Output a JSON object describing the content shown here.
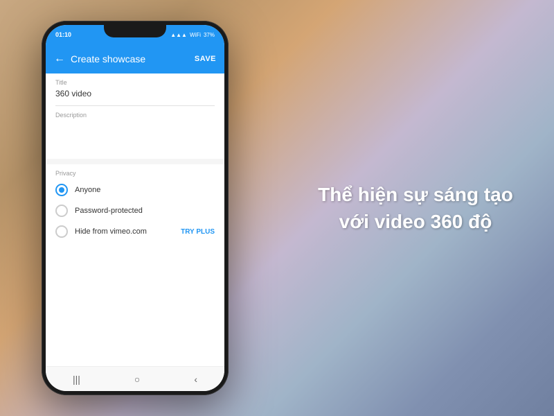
{
  "background": {
    "gradient": "linear-gradient(135deg, #c8a882, #b8956a, #c4b8d0, #8090b0)"
  },
  "right_text": {
    "line1": "Thể hiện sự sáng tạo",
    "line2": "với video 360 độ"
  },
  "phone": {
    "status_bar": {
      "time": "01:10",
      "battery": "37%"
    },
    "header": {
      "back_label": "←",
      "title": "Create showcase",
      "save_label": "SAVE"
    },
    "form": {
      "title_label": "Title",
      "title_value": "360 video",
      "description_label": "Description",
      "privacy_label": "Privacy",
      "options": [
        {
          "label": "Anyone",
          "selected": true
        },
        {
          "label": "Password-protected",
          "selected": false
        },
        {
          "label": "Hide from vimeo.com",
          "selected": false,
          "badge": "TRY PLUS"
        }
      ]
    },
    "bottom_nav": {
      "recent_label": "|||",
      "home_label": "○",
      "back_label": "‹"
    }
  }
}
